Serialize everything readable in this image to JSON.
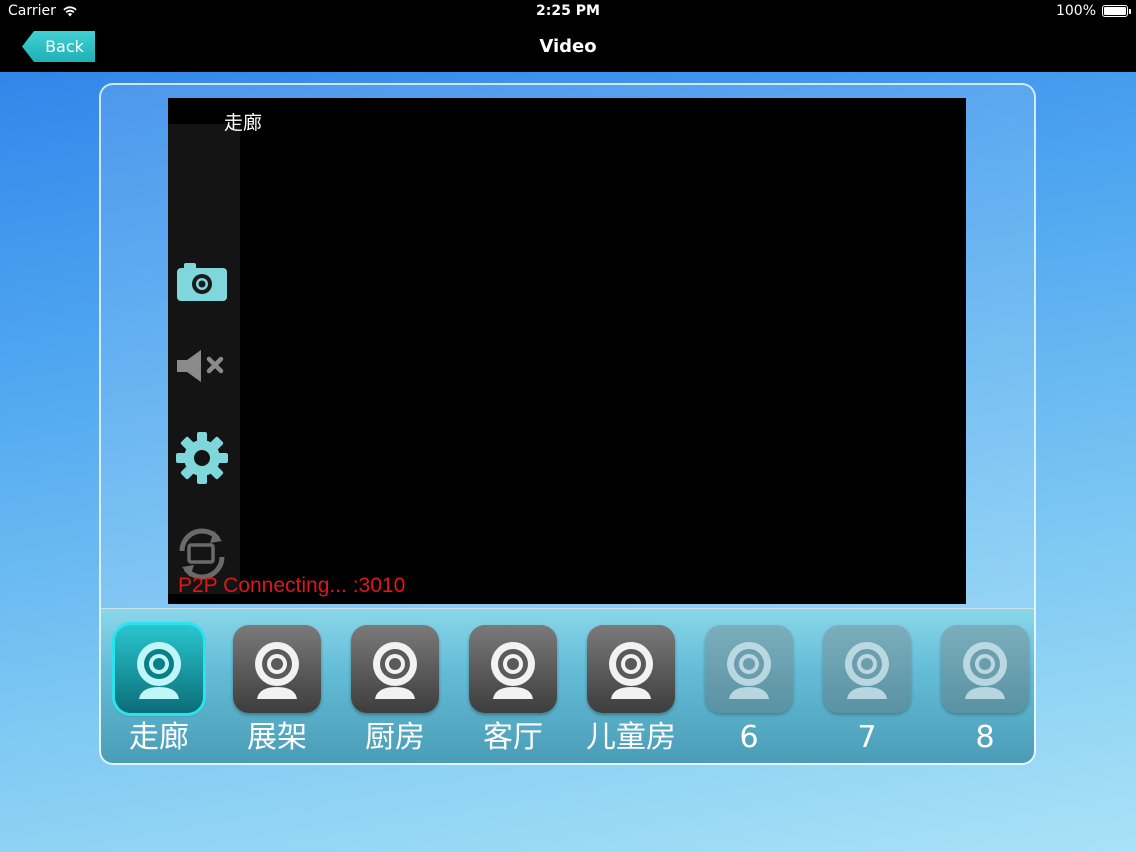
{
  "status_bar": {
    "carrier": "Carrier",
    "time": "2:25 PM",
    "battery": "100%"
  },
  "nav": {
    "back_label": "Back",
    "title": "Video"
  },
  "video": {
    "camera_name": "走廊",
    "connection_status": "P2P Connecting... :3010"
  },
  "tools": [
    {
      "icon": "camera-icon"
    },
    {
      "icon": "mute-icon"
    },
    {
      "icon": "gear-icon"
    },
    {
      "icon": "rotate-screen-icon"
    }
  ],
  "cameras": [
    {
      "label": "走廊",
      "state": "active"
    },
    {
      "label": "展架",
      "state": "normal"
    },
    {
      "label": "厨房",
      "state": "normal"
    },
    {
      "label": "客厅",
      "state": "normal"
    },
    {
      "label": "儿童房",
      "state": "normal"
    },
    {
      "label": "6",
      "state": "dim"
    },
    {
      "label": "7",
      "state": "dim"
    },
    {
      "label": "8",
      "state": "dim"
    }
  ],
  "colors": {
    "accent": "#2ac6cf",
    "status_text": "#e0161b"
  }
}
